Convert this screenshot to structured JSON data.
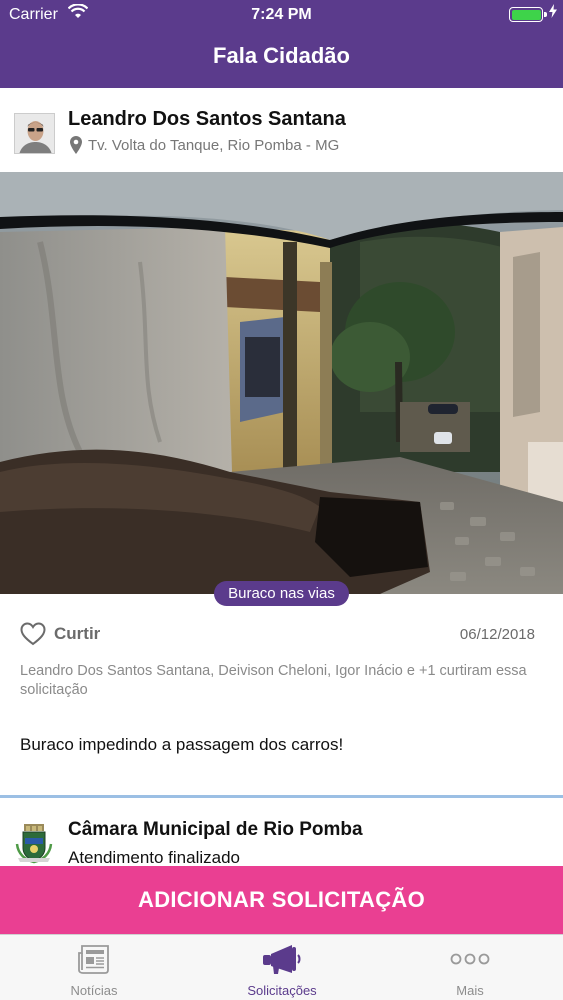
{
  "status_bar": {
    "carrier": "Carrier",
    "time": "7:24 PM"
  },
  "header": {
    "title": "Fala Cidadão"
  },
  "feed": {
    "post": {
      "author": "Leandro Dos Santos Santana",
      "location": "Tv. Volta do Tanque, Rio Pomba - MG",
      "category": "Buraco nas vias",
      "like_label": "Curtir",
      "date": "06/12/2018",
      "likers": "Leandro Dos Santos Santana, Deivison Cheloni, Igor Inácio e +1 curtiram essa solicitação",
      "description": "Buraco impedindo a passagem dos carros!"
    },
    "response": {
      "organization": "Câmara Municipal de Rio Pomba",
      "status": "Atendimento finalizado"
    }
  },
  "add_button": {
    "label": "ADICIONAR SOLICITAÇÃO"
  },
  "tabs": [
    {
      "label": "Notícias",
      "icon": "newspaper-icon"
    },
    {
      "label": "Solicitações",
      "icon": "megaphone-icon"
    },
    {
      "label": "Mais",
      "icon": "more-dots-icon"
    }
  ],
  "colors": {
    "primary": "#5b3b8c",
    "accent": "#ea3f92",
    "battery": "#3ed34a"
  }
}
